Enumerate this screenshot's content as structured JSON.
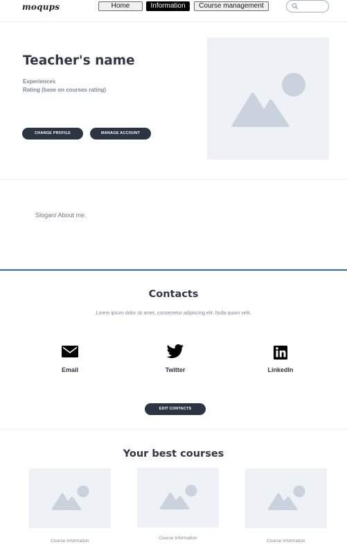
{
  "nav": {
    "logo": "moqups",
    "home": "Home",
    "information": "Information",
    "course_management": "Course management",
    "search_placeholder": ""
  },
  "profile": {
    "name": "Teacher's name",
    "experiences": "Experiences",
    "rating": "Rating (base on courses rating)",
    "change_profile": "CHANGE PROFILE",
    "manage_account": "MANAGE ACCOUNT",
    "image_icon": "image-placeholder-icon"
  },
  "about": {
    "slogan": "Slogan/ About me."
  },
  "contacts": {
    "title": "Contacts",
    "text": "Lorem ipsum dolor sit amet, consectetur adipiscing elit. Nulla quam velit.",
    "items": [
      {
        "label": "Email",
        "icon": "email-icon"
      },
      {
        "label": "Twitter",
        "icon": "twitter-icon"
      },
      {
        "label": "LinkedIn",
        "icon": "linkedin-icon"
      }
    ],
    "edit": "EDIT CONTACTS"
  },
  "courses": {
    "title": "Your best courses",
    "items": [
      {
        "label": "Course Information"
      },
      {
        "label": "Course Information"
      },
      {
        "label": "Course Information"
      }
    ]
  },
  "colors": {
    "accent_dark": "#2d3442",
    "divider_blue": "#2f6ea8",
    "placeholder_bg": "#eef1f5",
    "placeholder_icon": "#c9d2dd"
  }
}
